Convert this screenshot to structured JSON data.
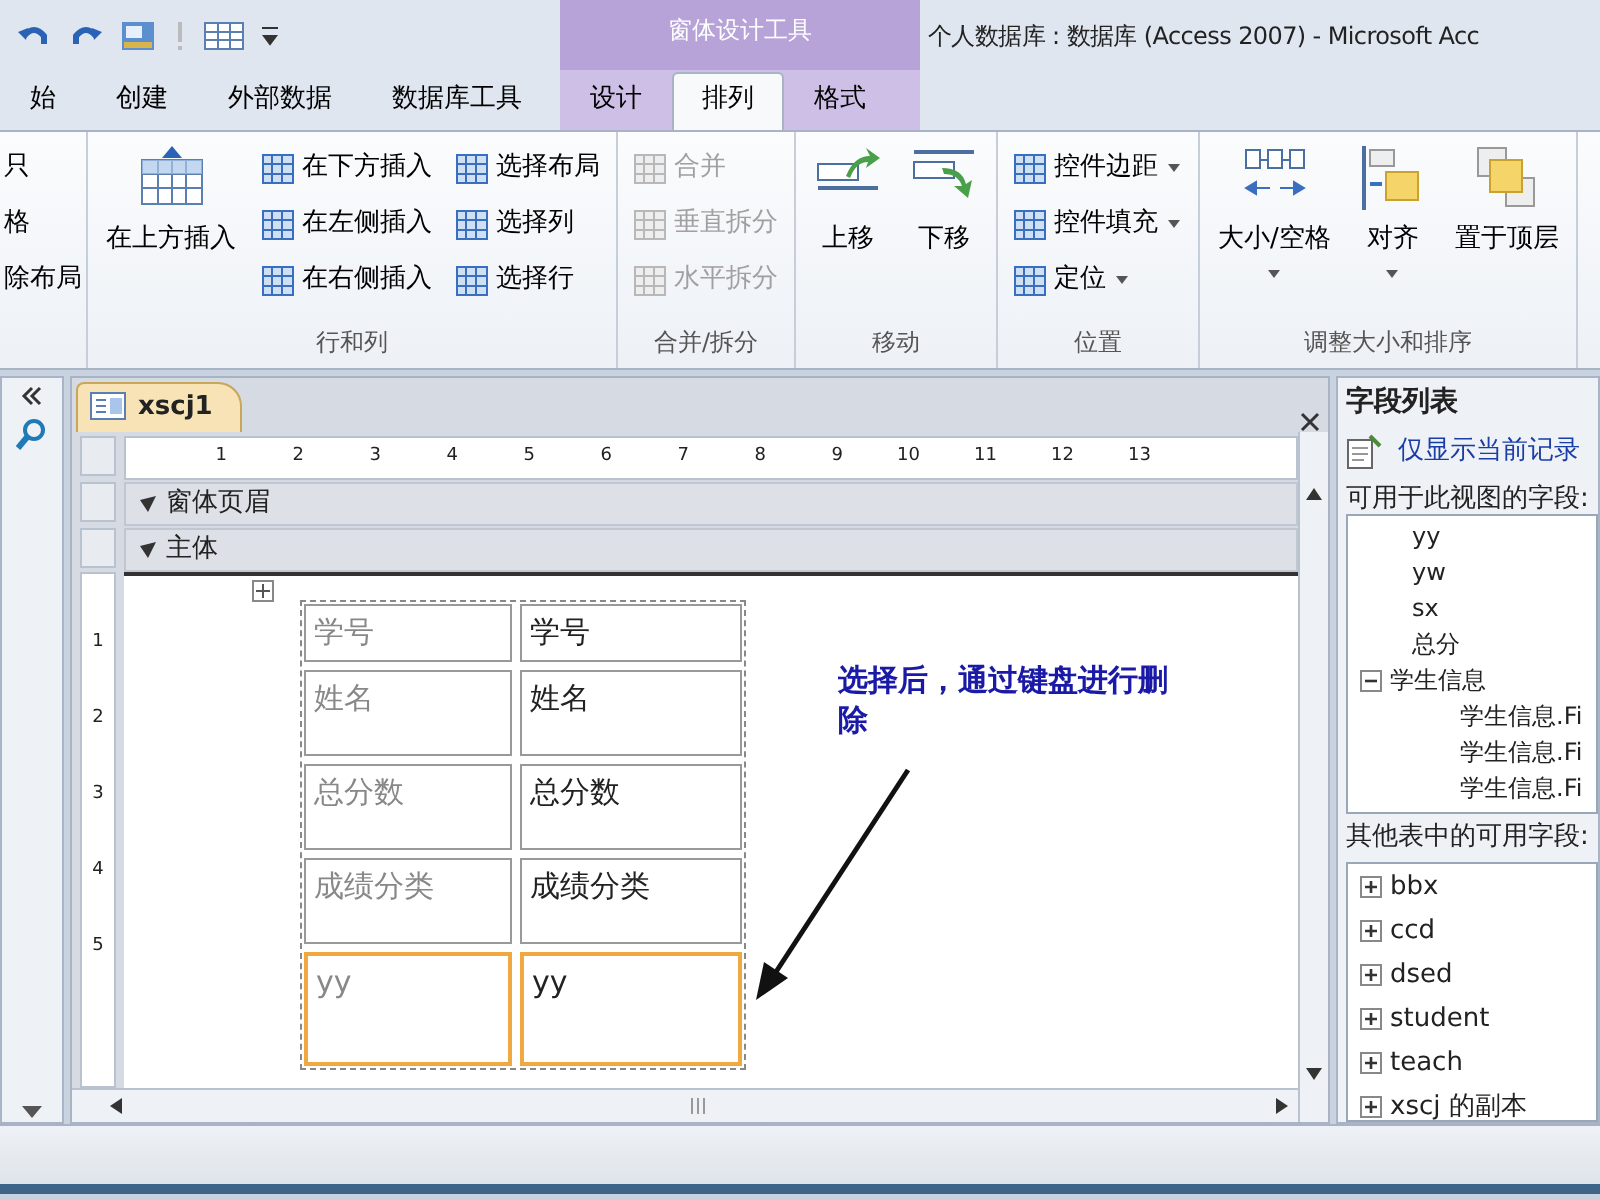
{
  "window": {
    "contextual_group": "窗体设计工具",
    "title": "个人数据库 : 数据库 (Access 2007) - Microsoft Acc"
  },
  "tabs": [
    {
      "label": "始",
      "selected": false
    },
    {
      "label": "创建",
      "selected": false
    },
    {
      "label": "外部数据",
      "selected": false
    },
    {
      "label": "数据库工具",
      "selected": false
    },
    {
      "label": "设计",
      "selected": false
    },
    {
      "label": "排列",
      "selected": true
    },
    {
      "label": "格式",
      "selected": false
    }
  ],
  "ribbon_groups": [
    {
      "items": [
        {
          "label": "只",
          "kind": "text"
        },
        {
          "label": "格",
          "kind": "text"
        },
        {
          "label": "除布局",
          "kind": "text"
        }
      ]
    },
    {
      "label": "行和列",
      "items": [
        {
          "label": "在上方插入",
          "kind": "large"
        },
        {
          "label": "在下方插入",
          "kind": "small"
        },
        {
          "label": "在左侧插入",
          "kind": "small"
        },
        {
          "label": "在右侧插入",
          "kind": "small"
        },
        {
          "label": "选择布局",
          "kind": "small"
        },
        {
          "label": "选择列",
          "kind": "small"
        },
        {
          "label": "选择行",
          "kind": "small"
        }
      ]
    },
    {
      "label": "合并/拆分",
      "items": [
        {
          "label": "合并",
          "kind": "small",
          "disabled": true
        },
        {
          "label": "垂直拆分",
          "kind": "small",
          "disabled": true
        },
        {
          "label": "水平拆分",
          "kind": "small",
          "disabled": true
        }
      ]
    },
    {
      "label": "移动",
      "items": [
        {
          "label": "上移",
          "kind": "large"
        },
        {
          "label": "下移",
          "kind": "large"
        }
      ]
    },
    {
      "label": "位置",
      "items": [
        {
          "label": "控件边距",
          "kind": "small",
          "dropdown": true
        },
        {
          "label": "控件填充",
          "kind": "small",
          "dropdown": true
        },
        {
          "label": "定位",
          "kind": "small",
          "dropdown": true
        }
      ]
    },
    {
      "label": "调整大小和排序",
      "items": [
        {
          "label": "大小/空格",
          "kind": "large",
          "dropdown": true
        },
        {
          "label": "对齐",
          "kind": "large",
          "dropdown": true
        },
        {
          "label": "置于顶层",
          "kind": "large"
        }
      ]
    }
  ],
  "document": {
    "tab": "xscj1",
    "ruler": [
      "1",
      "2",
      "3",
      "4",
      "5",
      "6",
      "7",
      "8",
      "9",
      "10",
      "11",
      "12",
      "13"
    ],
    "vertical_ruler": [
      "1",
      "2",
      "3",
      "4",
      "5"
    ],
    "sections": [
      "窗体页眉",
      "主体"
    ],
    "controls": [
      {
        "label": "学号",
        "value": "学号",
        "selected": false
      },
      {
        "label": "姓名",
        "value": "姓名",
        "selected": false
      },
      {
        "label": "总分数",
        "value": "总分数",
        "selected": false
      },
      {
        "label": "成绩分类",
        "value": "成绩分类",
        "selected": false
      },
      {
        "label": "yy",
        "value": "yy",
        "selected": true
      }
    ],
    "annotation": "选择后，通过键盘进行删除"
  },
  "field_list": {
    "title": "字段列表",
    "link": "仅显示当前记录",
    "available_label": "可用于此视图的字段:",
    "available_fields": [
      {
        "label": "yy"
      },
      {
        "label": "yw"
      },
      {
        "label": "sx"
      },
      {
        "label": "总分"
      },
      {
        "label": "学生信息",
        "expanded": true,
        "children": [
          {
            "label": "学生信息.Fi"
          },
          {
            "label": "学生信息.Fi"
          },
          {
            "label": "学生信息.Fi"
          }
        ]
      }
    ],
    "other_label": "其他表中的可用字段:",
    "other_tables": [
      {
        "label": "bbx",
        "expanded": false
      },
      {
        "label": "ccd",
        "expanded": false
      },
      {
        "label": "dsed",
        "expanded": false
      },
      {
        "label": "student",
        "expanded": false
      },
      {
        "label": "teach",
        "expanded": false
      },
      {
        "label": "xscj 的副本",
        "expanded": false
      }
    ]
  }
}
